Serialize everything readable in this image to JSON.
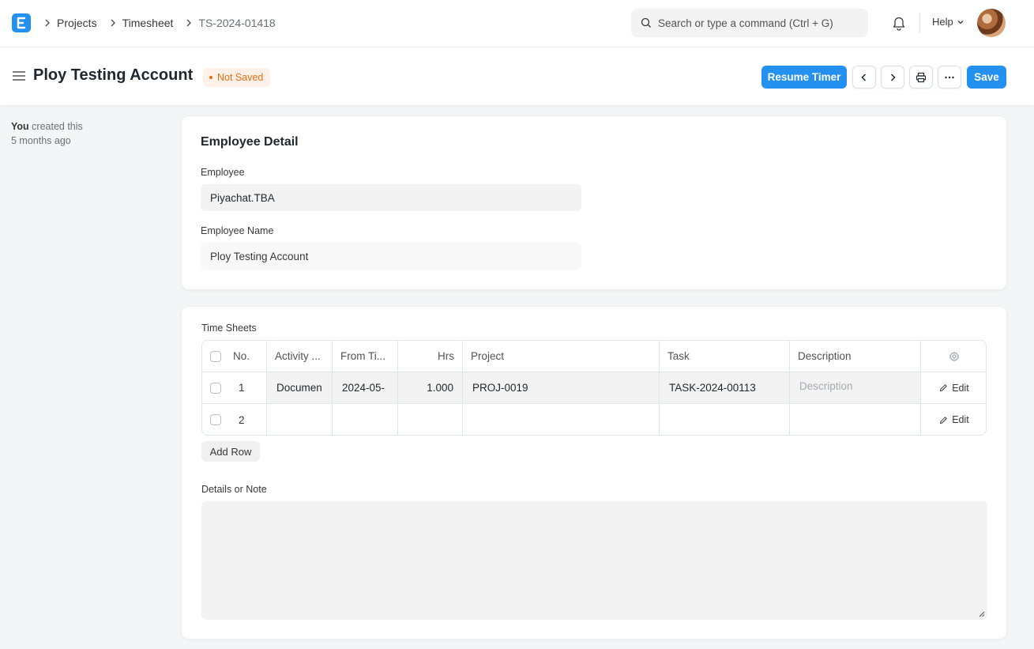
{
  "breadcrumbs": [
    "Projects",
    "Timesheet",
    "TS-2024-01418"
  ],
  "search": {
    "placeholder": "Search or type a command (Ctrl + G)"
  },
  "nav": {
    "help_label": "Help"
  },
  "page": {
    "title": "Ploy Testing Account",
    "status_badge": "Not Saved",
    "resume_timer_label": "Resume Timer",
    "save_label": "Save"
  },
  "timeline": {
    "actor": "You",
    "action": "created this",
    "when": "5 months ago"
  },
  "employee_detail": {
    "section_title": "Employee Detail",
    "employee_label": "Employee",
    "employee_value": "Piyachat.TBA",
    "employee_name_label": "Employee Name",
    "employee_name_value": "Ploy Testing Account"
  },
  "time_sheets": {
    "label": "Time Sheets",
    "columns": [
      "No.",
      "Activity ...",
      "From Ti...",
      "Hrs",
      "Project",
      "Task",
      "Description"
    ],
    "rows": [
      {
        "no": "1",
        "activity": "Documen",
        "from_time": "2024-05-",
        "hrs": "1.000",
        "project": "PROJ-0019",
        "task": "TASK-2024-00113",
        "description_placeholder": "Description"
      },
      {
        "no": "2",
        "activity": "",
        "from_time": "",
        "hrs": "",
        "project": "",
        "task": "",
        "description_placeholder": ""
      }
    ],
    "edit_label": "Edit",
    "add_row_label": "Add Row"
  },
  "details_note": {
    "label": "Details or Note",
    "value": ""
  },
  "colors": {
    "primary": "#2490ef",
    "warning_text": "#e86c13",
    "warning_bg": "#fff1e7"
  }
}
